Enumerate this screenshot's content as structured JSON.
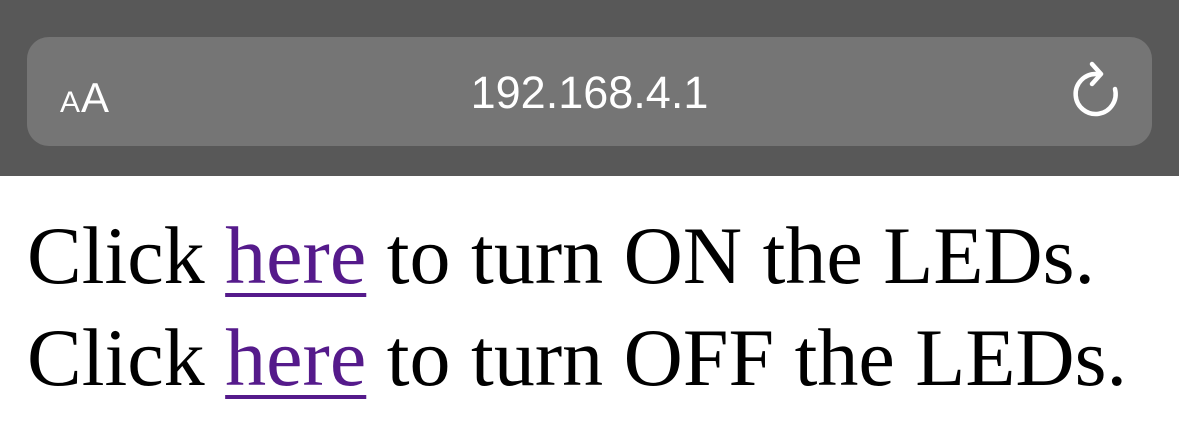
{
  "browser": {
    "text_size_button": {
      "small": "A",
      "large": "A"
    },
    "url": "192.168.4.1",
    "reload_icon": "reload-icon"
  },
  "page": {
    "lines": [
      {
        "prefix": "Click ",
        "link": "here",
        "suffix": " to turn ON the LEDs."
      },
      {
        "prefix": "Click ",
        "link": "here",
        "suffix": " to turn OFF the LEDs."
      }
    ],
    "link_color": "#551a8b"
  },
  "colors": {
    "toolbar": "#585858",
    "address_bar": "#757575",
    "toolbar_text": "#ffffff"
  }
}
